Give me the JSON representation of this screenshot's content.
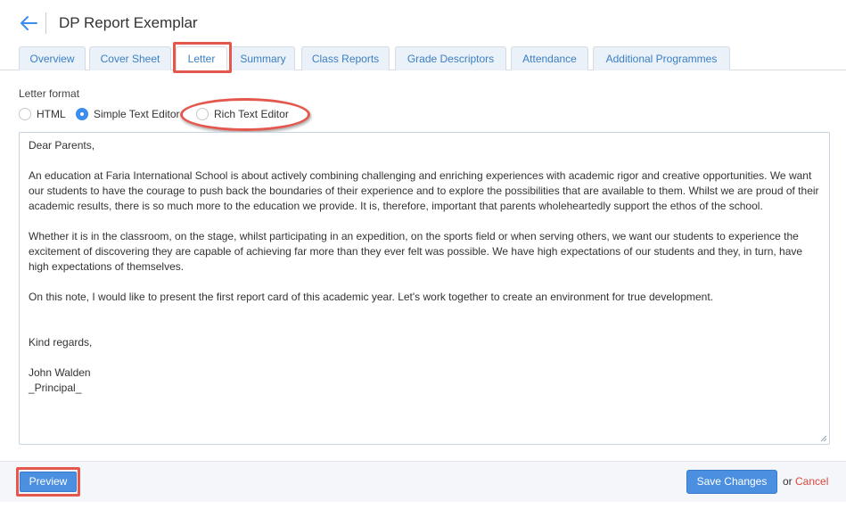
{
  "header": {
    "back_icon": "arrow-left-icon",
    "title": "DP Report Exemplar"
  },
  "tabs": [
    {
      "label": "Overview",
      "active": false
    },
    {
      "label": "Cover Sheet",
      "active": false
    },
    {
      "label": "Letter",
      "active": true
    },
    {
      "label": "Summary",
      "active": false
    },
    {
      "label": "Class Reports",
      "active": false
    },
    {
      "label": "Grade Descriptors",
      "active": false
    },
    {
      "label": "Attendance",
      "active": false
    },
    {
      "label": "Additional Programmes",
      "active": false
    }
  ],
  "letter_format": {
    "label": "Letter format",
    "options": [
      {
        "label": "HTML",
        "selected": false
      },
      {
        "label": "Simple Text Editor",
        "selected": true
      },
      {
        "label": "Rich Text Editor",
        "selected": false
      }
    ]
  },
  "editor": {
    "paragraphs": [
      "Dear Parents,",
      "An education at Faria International School is about actively combining challenging and enriching experiences with academic rigor and creative opportunities. We want our students to have the courage to push back the boundaries of their experience and to explore the possibilities that are available to them. Whilst we are proud of their academic results, there is so much more to the education we provide. It is, therefore, important that parents wholeheartedly support the ethos of the school.",
      "Whether it is in the classroom, on the stage, whilst participating in an expedition, on the sports field or when serving others, we want our students to experience the excitement of discovering they are capable of achieving far more than they ever felt was possible. We have high expectations of our students and they, in turn, have high expectations of themselves.",
      "On this note, I would like to present the first report card of this academic year. Let's work together to create an environment for true development.",
      "Kind regards,",
      "John Walden",
      "_Principal_"
    ]
  },
  "footer": {
    "preview_label": "Preview",
    "save_label": "Save Changes",
    "or_text": "or",
    "cancel_label": "Cancel"
  },
  "colors": {
    "accent": "#4a8fe0",
    "tab_text": "#3b7fc4",
    "highlight": "#e4574c",
    "cancel": "#d9463d"
  }
}
